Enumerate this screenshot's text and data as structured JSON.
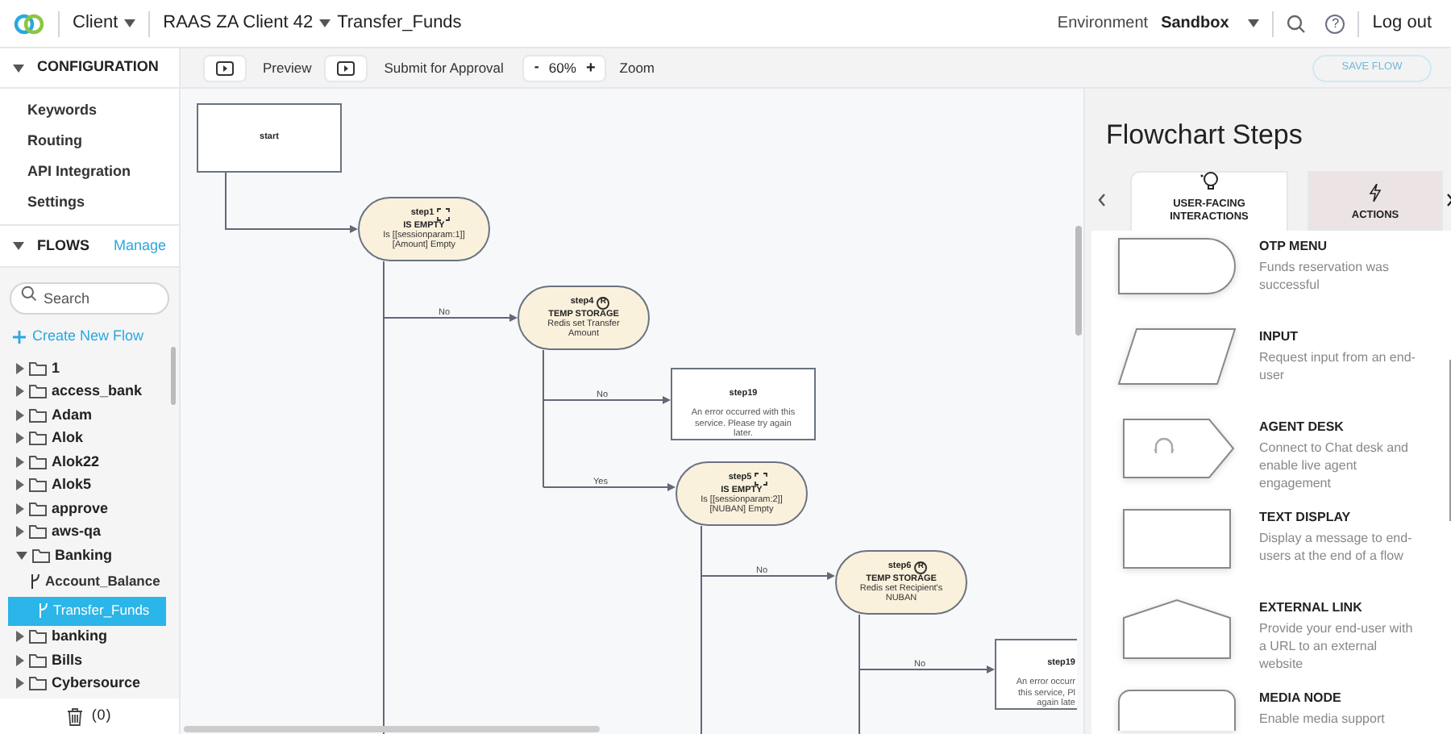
{
  "topbar": {
    "client": "Client",
    "project": "RAAS ZA Client 42",
    "flow": "Transfer_Funds",
    "environment_label": "Environment",
    "environment": "Sandbox",
    "help": "?",
    "logout": "Log out"
  },
  "toolbar": {
    "preview": "Preview",
    "submit": "Submit for Approval",
    "zoom_minus": "-",
    "zoom_value": "60%",
    "zoom_plus": "+",
    "zoom_label": "Zoom",
    "save": {
      "label": "SAVE FLOW",
      "disabled": true
    }
  },
  "sidebar": {
    "configuration": {
      "title": "CONFIGURATION",
      "expanded": true,
      "items": [
        "Keywords",
        "Routing",
        "API Integration",
        "Settings"
      ]
    },
    "flows": {
      "title": "FLOWS",
      "expanded": true,
      "manage": "Manage",
      "search": {
        "placeholder": "Search"
      },
      "create": "Create New Flow",
      "tree": [
        {
          "kind": "folder",
          "label": "1",
          "expanded": false,
          "selected": false
        },
        {
          "kind": "folder",
          "label": "access_bank",
          "expanded": false,
          "selected": false
        },
        {
          "kind": "folder",
          "label": "Adam",
          "expanded": false,
          "selected": false
        },
        {
          "kind": "folder",
          "label": "Alok",
          "expanded": false,
          "selected": false
        },
        {
          "kind": "folder",
          "label": "Alok22",
          "expanded": false,
          "selected": false
        },
        {
          "kind": "folder",
          "label": "Alok5",
          "expanded": false,
          "selected": false
        },
        {
          "kind": "folder",
          "label": "approve",
          "expanded": false,
          "selected": false
        },
        {
          "kind": "folder",
          "label": "aws-qa",
          "expanded": false,
          "selected": false
        },
        {
          "kind": "folder",
          "label": "Banking",
          "expanded": true,
          "selected": false,
          "children": [
            {
              "kind": "flow",
              "label": "Account_Balance",
              "selected": false
            },
            {
              "kind": "flow",
              "label": "Transfer_Funds",
              "selected": true
            }
          ]
        },
        {
          "kind": "folder",
          "label": "banking",
          "expanded": false,
          "selected": false
        },
        {
          "kind": "folder",
          "label": "Bills",
          "expanded": false,
          "selected": false
        },
        {
          "kind": "folder",
          "label": "Cybersource",
          "expanded": false,
          "selected": false
        }
      ]
    },
    "trash_count": "(0)"
  },
  "canvas": {
    "nodes": [
      {
        "kind": "start",
        "title": "start"
      },
      {
        "kind": "condition",
        "title": "step1",
        "type": "IS EMPTY",
        "text": "Is [[sessionparam:1]] [Amount] Empty"
      },
      {
        "kind": "storage",
        "title": "step4",
        "badge": "R",
        "type": "TEMP STORAGE",
        "text": "Redis set Transfer Amount"
      },
      {
        "kind": "message",
        "title": "step19",
        "text": "An error occurred with this service. Please try again later."
      },
      {
        "kind": "condition",
        "title": "step5",
        "type": "IS EMPTY",
        "text": "Is [[sessionparam:2]] [NUBAN] Empty"
      },
      {
        "kind": "storage",
        "title": "step6",
        "badge": "R",
        "type": "TEMP STORAGE",
        "text": "Redis set Recipient's NUBAN"
      },
      {
        "kind": "message",
        "title": "step19",
        "text": "An error occurr\nthis service, Pl\nagain late"
      }
    ],
    "edge_labels": [
      "No",
      "No",
      "Yes",
      "No",
      "No"
    ]
  },
  "panel": {
    "title": "Flowchart Steps",
    "tabs": [
      {
        "label": "USER-FACING INTERACTIONS",
        "selected": true
      },
      {
        "label": "ACTIONS",
        "selected": false
      }
    ],
    "steps": [
      {
        "kind": "otp_menu",
        "title": "OTP MENU",
        "description": "Funds reservation was successful"
      },
      {
        "kind": "input",
        "title": "INPUT",
        "description": "Request input from an end-user"
      },
      {
        "kind": "agent_desk",
        "title": "AGENT DESK",
        "description": "Connect to Chat desk and enable live agent engagement"
      },
      {
        "kind": "text_display",
        "title": "TEXT DISPLAY",
        "description": "Display a message to end-users at the end of a flow"
      },
      {
        "kind": "external_link",
        "title": "EXTERNAL LINK",
        "description": "Provide your end-user with a URL to an external website"
      },
      {
        "kind": "media_node",
        "title": "MEDIA NODE",
        "description": "Enable media support"
      }
    ]
  }
}
